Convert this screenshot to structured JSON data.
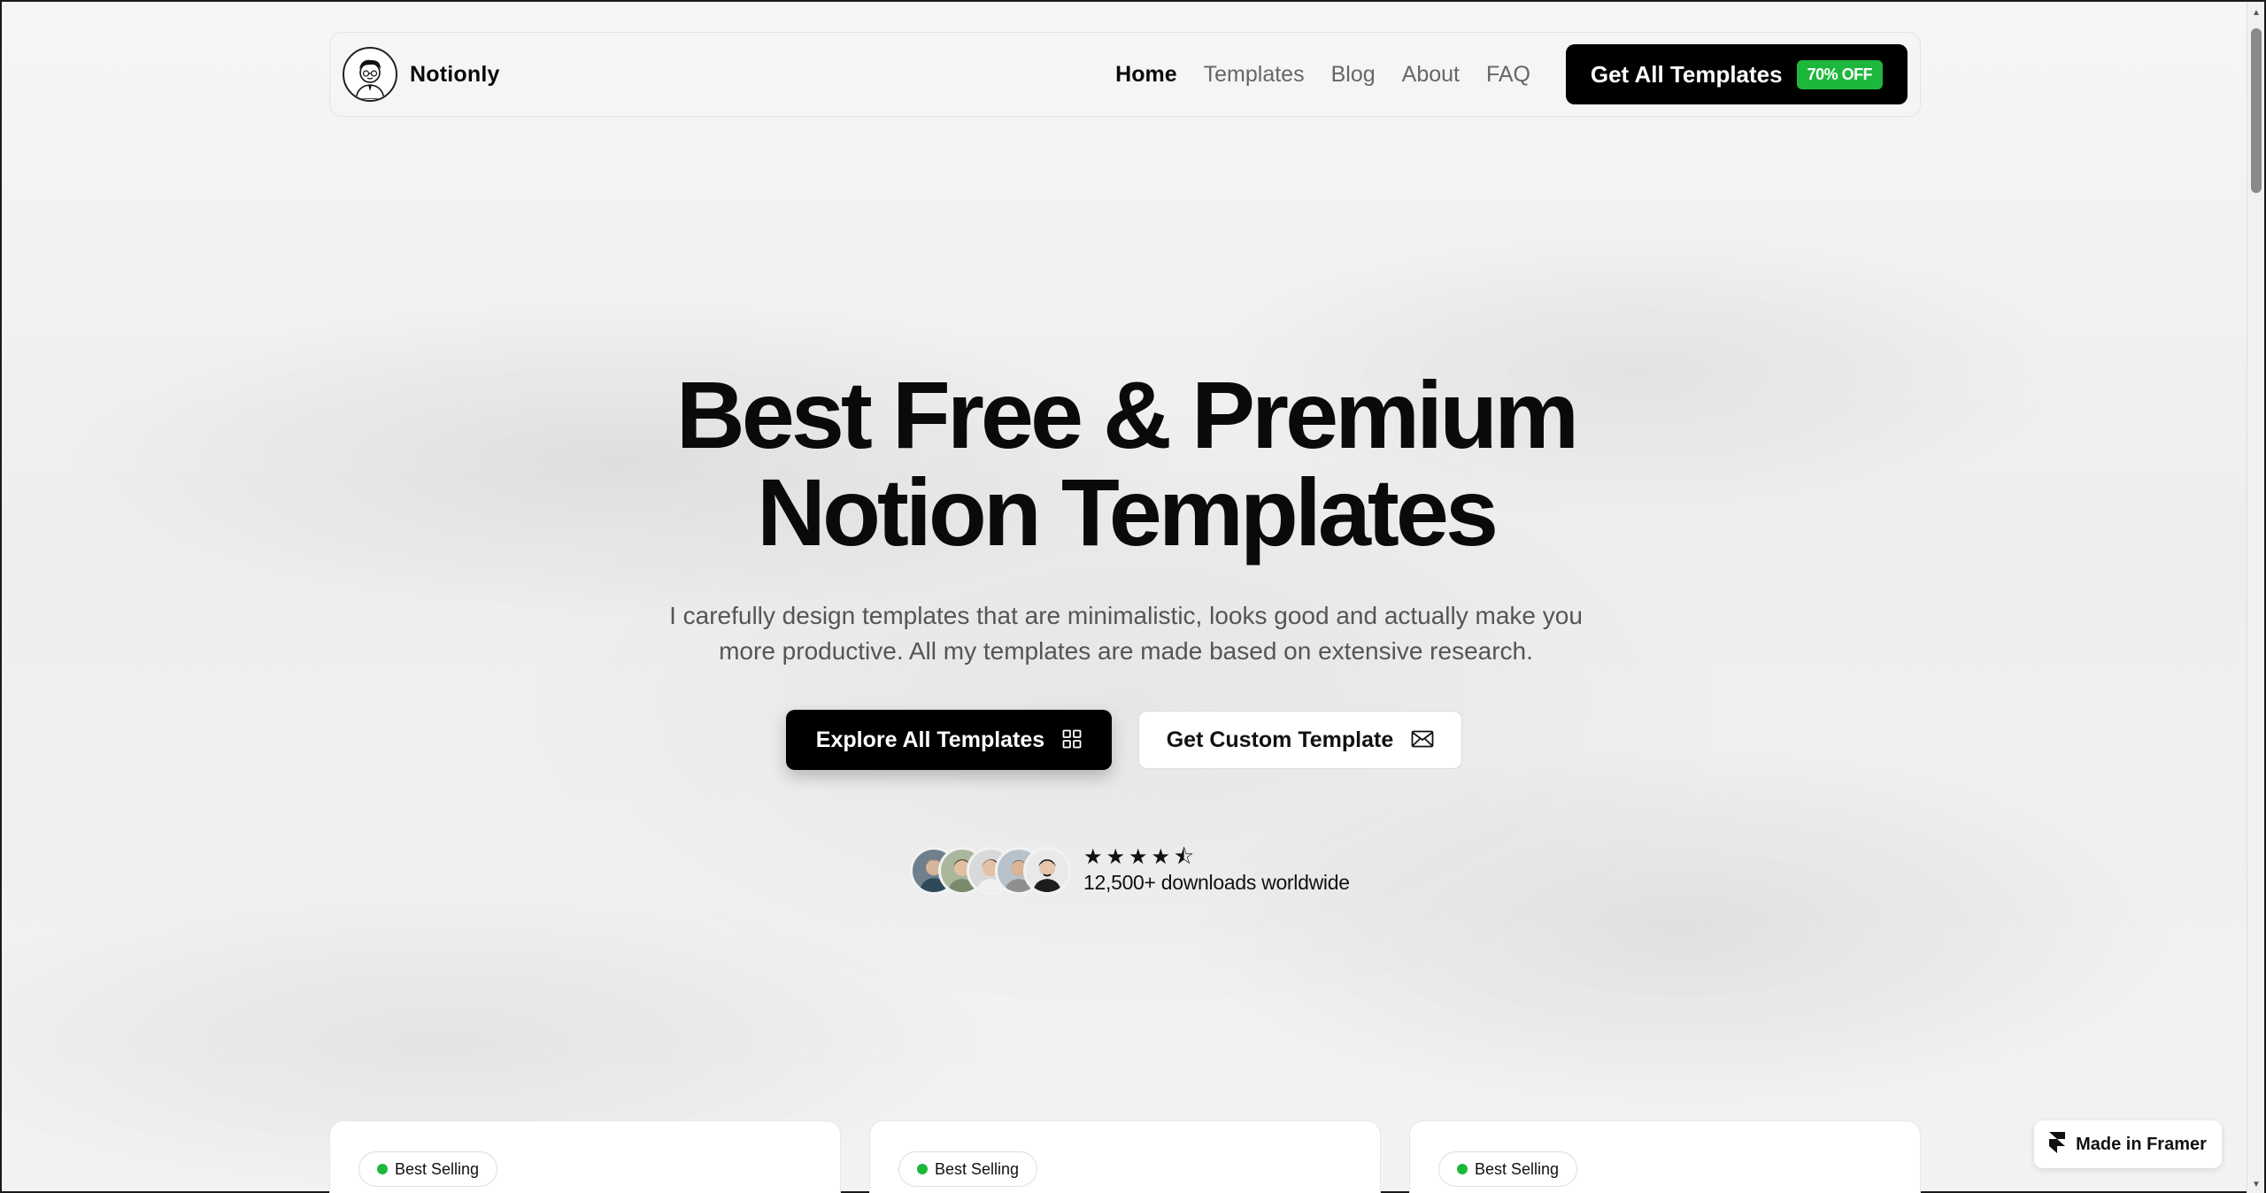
{
  "brand": {
    "name": "Notionly",
    "logo_icon": "cartoon-avatar-icon"
  },
  "nav": {
    "links": [
      {
        "label": "Home",
        "active": true
      },
      {
        "label": "Templates",
        "active": false
      },
      {
        "label": "Blog",
        "active": false
      },
      {
        "label": "About",
        "active": false
      },
      {
        "label": "FAQ",
        "active": false
      }
    ],
    "cta": {
      "label": "Get All Templates",
      "badge": "70% OFF"
    }
  },
  "hero": {
    "title_line1": "Best Free & Premium",
    "title_line2": "Notion Templates",
    "subtitle_line1": "I carefully design templates that are minimalistic, looks good and actually make you",
    "subtitle_line2": "more productive. All my templates are made based on extensive research.",
    "primary_button": {
      "label": "Explore All Templates",
      "icon": "grid-icon"
    },
    "secondary_button": {
      "label": "Get Custom Template",
      "icon": "mail-icon"
    }
  },
  "social_proof": {
    "avatar_count": 5,
    "rating": 4.5,
    "stars": [
      "★",
      "★",
      "★",
      "★",
      "⯪"
    ],
    "text": "12,500+ downloads worldwide"
  },
  "cards": [
    {
      "badge": "Best Selling"
    },
    {
      "badge": "Best Selling"
    },
    {
      "badge": "Best Selling"
    }
  ],
  "framer_badge": {
    "label": "Made in Framer",
    "icon": "framer-logo-icon"
  },
  "colors": {
    "accent_green": "#1db83b",
    "primary_black": "#000000",
    "muted_text": "#555555"
  }
}
